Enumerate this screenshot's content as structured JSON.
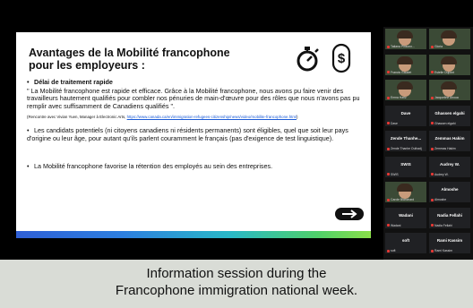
{
  "slide": {
    "title_line1": "Avantages de la Mobilité francophone",
    "title_line2": "pour les employeurs :",
    "bullet1_heading": "Délai de traitement rapide",
    "bullet1_body": "\" La Mobilité francophone est rapide et efficace. Grâce à la Mobilité francophone, nous avons pu faire venir des travailleurs hautement qualifiés pour combler nos pénuries de main-d'œuvre pour des rôles que nous n'avons pas pu remplir avec suffisamment de Canadiens qualifiés \".",
    "note_text": "(Rencontre avec Vivian Yuen, Manager à Electronic Arts, ",
    "note_url": "https://www.canada.ca/en/immigration-refugees-citizenship/news/video/mobilite-francophone.html",
    "note_end": ")",
    "bullet2": "Les candidats potentiels (ni citoyens canadiens ni résidents permanents) sont éligibles, quel que soit leur pays d'origine ou leur âge, pour autant qu'ils parlent couramment le français (pas d'exigence de test linguistique).",
    "bullet3": "La Mobilité francophone favorise la rétention des employés au sein des entreprises.",
    "icons": [
      "stopwatch-icon",
      "dollar-icon",
      "arrow-right-icon"
    ],
    "colors": {
      "footer_start": "#2f5fd6",
      "footer_end": "#8be04a"
    }
  },
  "participants": [
    {
      "name": "",
      "sub": "Tatiana Pinsonn..."
    },
    {
      "name": "",
      "sub": "Gloria"
    },
    {
      "name": "",
      "sub": "Francis Gaudet"
    },
    {
      "name": "",
      "sub": "Estelle Dupont"
    },
    {
      "name": "",
      "sub": "Emna Hariz"
    },
    {
      "name": "",
      "sub": "Jacqueline Ahoua"
    },
    {
      "name": "Dave",
      "sub": "Dave"
    },
    {
      "name": "Ghassen elgahi",
      "sub": "Ghassen elgahi"
    },
    {
      "name": "Zende Thanhe...",
      "sub": "Zende Thanhe Oulhadj"
    },
    {
      "name": "Zemmas Hakim",
      "sub": "Zemmas Hakim"
    },
    {
      "name": "SWIS",
      "sub": "SWIS"
    },
    {
      "name": "Audrey W.",
      "sub": "Audrey W."
    },
    {
      "name": "",
      "sub": "Carole Blanchard"
    },
    {
      "name": "Almoshe",
      "sub": "Almoshe"
    },
    {
      "name": "Wadani",
      "sub": "Wadani"
    },
    {
      "name": "Nadia Fellahi",
      "sub": "Nadia Fellahi"
    },
    {
      "name": "soft",
      "sub": "soft"
    },
    {
      "name": "Rami Kassim",
      "sub": "Rami Kassim"
    }
  ],
  "caption": {
    "line1": "Information session during the",
    "line2": "Francophone immigration national week."
  }
}
